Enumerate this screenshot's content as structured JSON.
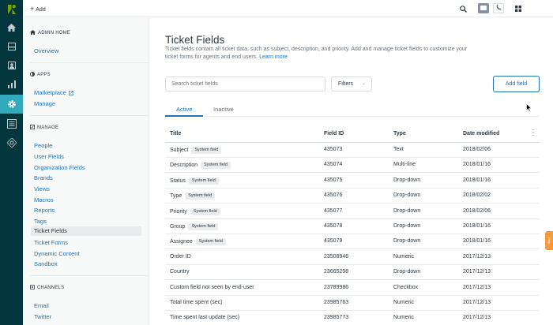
{
  "rail": {
    "items": [
      "logo-icon",
      "home-icon",
      "views-icon",
      "users-icon",
      "reporting-icon",
      "admin-icon",
      "apps-icon",
      "channels-icon"
    ]
  },
  "topbar": {
    "add_label": "Add"
  },
  "sidebar": {
    "admin_home": {
      "heading": "ADMIN HOME",
      "items": [
        "Overview"
      ]
    },
    "apps": {
      "heading": "APPS",
      "items": [
        "Marketplace",
        "Manage"
      ]
    },
    "manage": {
      "heading": "MANAGE",
      "items": [
        "People",
        "User Fields",
        "Organization Fields",
        "Brands",
        "Views",
        "Macros",
        "Reports",
        "Tags",
        "Ticket Fields",
        "Ticket Forms",
        "Dynamic Content",
        "Sandbox"
      ],
      "selected": "Ticket Fields"
    },
    "channels": {
      "heading": "CHANNELS",
      "items": [
        "Email",
        "Twitter"
      ]
    }
  },
  "main": {
    "title": "Ticket Fields",
    "description_1": "Ticket fields contain all ticket data, such as subject, description, and priority. Add and manage ticket fields to customize your ticket forms for agents and end users.",
    "learn_more": "Learn more",
    "search_placeholder": "Search ticket fields",
    "filters_label": "Filters",
    "add_field_label": "Add field",
    "tabs": [
      {
        "label": "Active",
        "active": true
      },
      {
        "label": "Inactive",
        "active": false
      }
    ],
    "columns": [
      "Title",
      "Field ID",
      "Type",
      "Date modified"
    ],
    "rows": [
      {
        "title": "Subject",
        "badge": "System field",
        "id": "435073",
        "type": "Text",
        "date": "2018/02/06"
      },
      {
        "title": "Description",
        "badge": "System field",
        "id": "435074",
        "type": "Multi-line",
        "date": "2018/01/16"
      },
      {
        "title": "Status",
        "badge": "System field",
        "id": "435075",
        "type": "Drop-down",
        "date": "2018/01/16"
      },
      {
        "title": "Type",
        "badge": "System field",
        "id": "435076",
        "type": "Drop-down",
        "date": "2018/02/02"
      },
      {
        "title": "Priority",
        "badge": "System field",
        "id": "435077",
        "type": "Drop-down",
        "date": "2018/02/06"
      },
      {
        "title": "Group",
        "badge": "System field",
        "id": "435078",
        "type": "Drop-down",
        "date": "2018/01/16"
      },
      {
        "title": "Assignee",
        "badge": "System field",
        "id": "435079",
        "type": "Drop-down",
        "date": "2018/01/16"
      },
      {
        "title": "Order ID",
        "badge": "",
        "id": "23508946",
        "type": "Numeric",
        "date": "2017/12/13"
      },
      {
        "title": "Country",
        "badge": "",
        "id": "23665258",
        "type": "Drop-down",
        "date": "2017/12/13"
      },
      {
        "title": "Custom field not seen by end-user",
        "badge": "",
        "id": "23789986",
        "type": "Checkbox",
        "date": "2017/12/13"
      },
      {
        "title": "Total time spent (sec)",
        "badge": "",
        "id": "23985763",
        "type": "Numeric",
        "date": "2017/12/13"
      },
      {
        "title": "Time spent last update (sec)",
        "badge": "",
        "id": "23985773",
        "type": "Numeric",
        "date": "2017/12/13"
      }
    ]
  },
  "feedback_label": "Help",
  "colors": {
    "rail": "#03363d",
    "rail_active": "#30aabc",
    "link": "#1f73b7",
    "feedback": "#f79a3e"
  }
}
